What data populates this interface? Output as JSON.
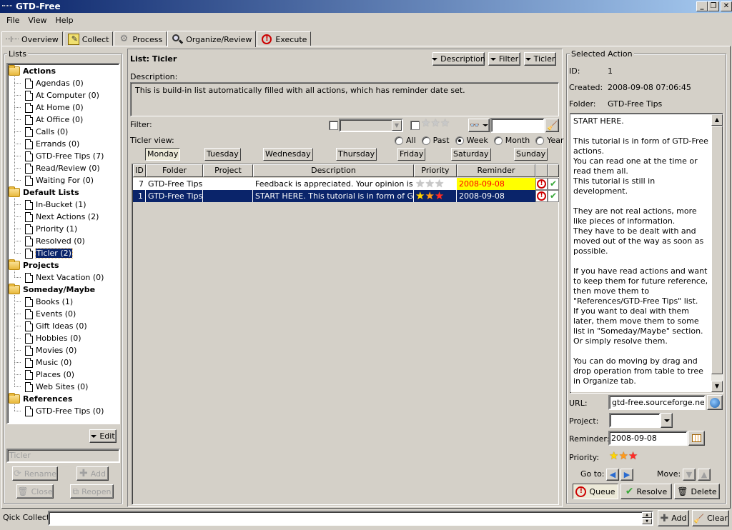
{
  "window": {
    "title": "GTD-Free",
    "controls": {
      "minimize": "_",
      "restore": "❐",
      "close": "✕"
    }
  },
  "menu": [
    "File",
    "View",
    "Help"
  ],
  "tabs": [
    {
      "label": "Overview",
      "icon": "overview-icon",
      "active": false
    },
    {
      "label": "Collect",
      "icon": "notepad-icon",
      "active": false
    },
    {
      "label": "Process",
      "icon": "gears-icon",
      "active": false
    },
    {
      "label": "Organize/Review",
      "icon": "magnifier-icon",
      "active": true
    },
    {
      "label": "Execute",
      "icon": "alarm-icon",
      "active": false
    }
  ],
  "lists_panel": {
    "title": "Lists",
    "tree": [
      {
        "label": "Actions",
        "type": "folder",
        "children": [
          {
            "label": "Agendas (0)"
          },
          {
            "label": "At Computer (0)"
          },
          {
            "label": "At Home (0)"
          },
          {
            "label": "At Office (0)"
          },
          {
            "label": "Calls (0)"
          },
          {
            "label": "Errands (0)"
          },
          {
            "label": "GTD-Free Tips (7)"
          },
          {
            "label": "Read/Review (0)"
          },
          {
            "label": "Waiting For (0)"
          }
        ]
      },
      {
        "label": "Default Lists",
        "type": "folder",
        "children": [
          {
            "label": "In-Bucket (1)"
          },
          {
            "label": "Next Actions (2)"
          },
          {
            "label": "Priority (1)"
          },
          {
            "label": "Resolved (0)"
          },
          {
            "label": "Ticler (2)",
            "selected": true
          }
        ]
      },
      {
        "label": "Projects",
        "type": "folder",
        "children": [
          {
            "label": "Next Vacation (0)"
          }
        ]
      },
      {
        "label": "Someday/Maybe",
        "type": "folder",
        "children": [
          {
            "label": "Books (1)"
          },
          {
            "label": "Events (0)"
          },
          {
            "label": "Gift Ideas (0)"
          },
          {
            "label": "Hobbies (0)"
          },
          {
            "label": "Movies (0)"
          },
          {
            "label": "Music (0)"
          },
          {
            "label": "Places (0)"
          },
          {
            "label": "Web Sites (0)"
          }
        ]
      },
      {
        "label": "References",
        "type": "folder",
        "children": [
          {
            "label": "GTD-Free Tips (0)"
          }
        ]
      }
    ],
    "edit_label": "Edit",
    "name_field_value": "Ticler",
    "rename_label": "Rename",
    "add_label": "Add",
    "close_label": "Close",
    "reopen_label": "Reopen"
  },
  "list_view": {
    "title": "List: Ticler",
    "toggle_description": "Description",
    "toggle_filter": "Filter",
    "toggle_ticler": "Ticler",
    "description_label": "Description:",
    "description": "This is build-in list automatically filled with all actions, which has reminder date set.",
    "filter_label": "Filter:",
    "filter_project_value": "",
    "filter_search_value": "",
    "ticler_view_label": "Ticler view:",
    "ticler_options": [
      {
        "label": "All",
        "checked": false
      },
      {
        "label": "Past",
        "checked": false
      },
      {
        "label": "Week",
        "checked": true
      },
      {
        "label": "Month",
        "checked": false
      },
      {
        "label": "Year",
        "checked": false
      }
    ],
    "days": [
      {
        "label": "Monday",
        "selected": true
      },
      {
        "label": "Tuesday",
        "selected": false
      },
      {
        "label": "Wednesday",
        "selected": false
      },
      {
        "label": "Thursday",
        "selected": false
      },
      {
        "label": "Friday",
        "selected": false
      },
      {
        "label": "Saturday",
        "selected": false
      },
      {
        "label": "Sunday",
        "selected": false
      }
    ],
    "table": {
      "columns": [
        "ID",
        "Folder",
        "Project",
        "Description",
        "Priority",
        "Reminder",
        "",
        ""
      ],
      "rows": [
        {
          "id": "7",
          "folder": "GTD-Free Tips",
          "project": "",
          "description": "Feedback is appreciated.   Your opinion is v...",
          "priority": 0,
          "reminder": "2008-09-08",
          "reminder_highlight": true,
          "selected": false
        },
        {
          "id": "1",
          "folder": "GTD-Free Tips",
          "project": "",
          "description": "START HERE.    This tutorial is in form of G...",
          "priority": 3,
          "reminder": "2008-09-08",
          "reminder_highlight": false,
          "selected": true
        }
      ]
    }
  },
  "selected_action": {
    "title": "Selected Action",
    "id_label": "ID:",
    "id": "1",
    "created_label": "Created:",
    "created": "2008-09-08 07:06:45",
    "folder_label": "Folder:",
    "folder": "GTD-Free Tips",
    "description": "START HERE.\n\nThis tutorial is in form of GTD-Free actions.\nYou can read one at the time or read them all.\nThis tutorial is still in development.\n\nThey are not real actions, more like pieces of information.\nThey have to be dealt with and moved out of the way as soon as possible.\n\nIf you have read actions and want to keep them for future reference, then move them to \"References/GTD-Free Tips\" list.\nIf you want to deal with them later, them move them to some list in \"Someday/Maybe\" section.\nOr simply resolve them.\n\nYou can do moving by drag and drop operation from table to tree in Organize tab.\n\nWhen you are done you can close the \"GTD-Free Tutorial\" list altogether.",
    "url_label": "URL:",
    "url": "gtd-free.sourceforge.net/",
    "project_label": "Project:",
    "project": "",
    "reminder_label": "Reminder:",
    "reminder": "2008-09-08",
    "priority_label": "Priority:",
    "priority": 3,
    "goto_label": "Go to:",
    "move_label": "Move:",
    "queue_label": "Queue",
    "resolve_label": "Resolve",
    "delete_label": "Delete"
  },
  "quick_collect": {
    "label": "Qick Collect:",
    "value": "",
    "add_label": "Add",
    "clear_label": "Clear"
  },
  "colors": {
    "selection": "#0a246a",
    "reminder_highlight_bg": "#ffff00",
    "reminder_highlight_fg": "#ff0000",
    "star_1": "#ffd700",
    "star_2": "#ff9a1a",
    "star_3": "#ff2a2a"
  }
}
